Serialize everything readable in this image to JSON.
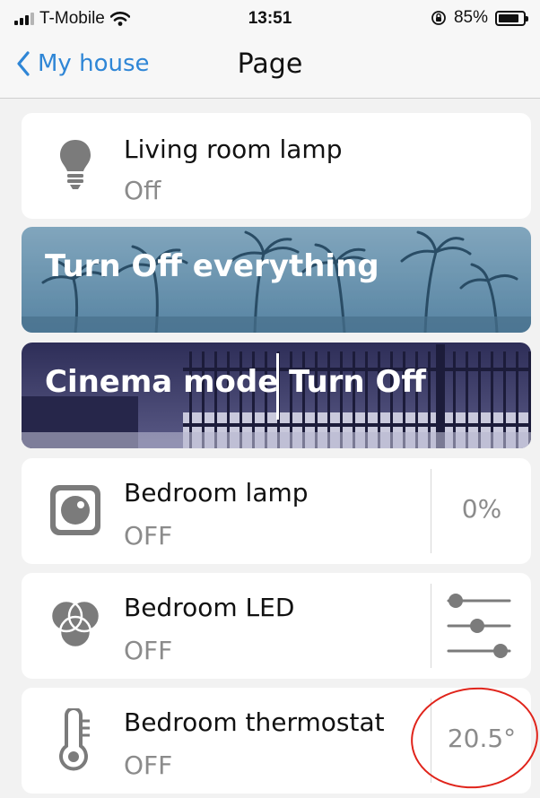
{
  "status_bar": {
    "carrier": "T-Mobile",
    "time": "13:51",
    "battery": "85%"
  },
  "nav": {
    "back_label": "My house",
    "title": "Page"
  },
  "devices": [
    {
      "name": "Living room lamp",
      "status": "Off"
    },
    {
      "name": "Bedroom lamp",
      "status": "OFF",
      "value": "0%"
    },
    {
      "name": "Bedroom LED",
      "status": "OFF"
    },
    {
      "name": "Bedroom thermostat",
      "status": "OFF",
      "value": "20.5°"
    }
  ],
  "scenes": [
    {
      "label": "Turn Off everything"
    },
    {
      "labels": [
        "Cinema mode",
        "Turn Off"
      ]
    }
  ],
  "colors": {
    "accent": "#2f86d6",
    "annotation": "#e0241b",
    "scene1_tint": "#5f8fae",
    "scene2_tint": "#3a3a66"
  },
  "icons": [
    "signal-icon",
    "wifi-icon",
    "orientation-lock-icon",
    "battery-icon",
    "back-chevron-icon",
    "lightbulb-icon",
    "dimmer-icon",
    "rgb-icon",
    "sliders-icon",
    "thermometer-icon"
  ]
}
